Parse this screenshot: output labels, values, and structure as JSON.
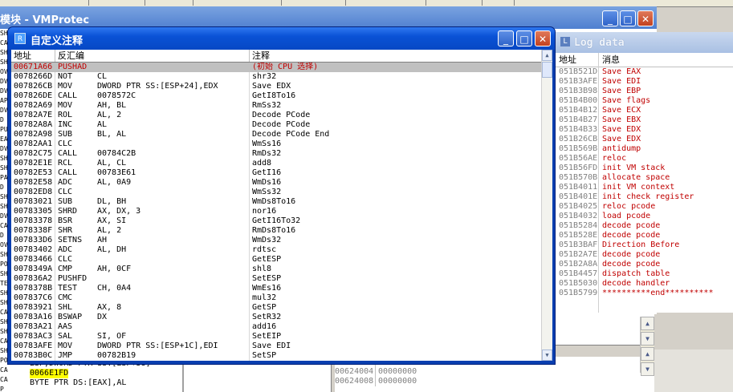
{
  "background_window": {
    "title": "模块 - VMProtec",
    "left_gutter": [
      "SH",
      "CA",
      "SH",
      "SH",
      "OV",
      "DV",
      "DV",
      "AP",
      "DV",
      "D",
      "PU",
      "EA",
      "DV",
      "SH",
      "SH",
      "PA",
      "D",
      "SH",
      "SH",
      "DV",
      "CA",
      "D",
      "OV",
      "SH",
      "PO",
      "SH",
      "TE",
      "SH",
      "SH",
      "CA",
      "SH",
      "SH",
      "CA",
      "SH",
      "PO",
      "CA",
      "CA",
      "P",
      "D"
    ],
    "bottom_rows": [
      {
        "op": "ESP,DWORD PTR SS:[ESP+38]"
      },
      {
        "op": "0066E1FD"
      },
      {
        "op": "BYTE PTR DS:[EAX],AL"
      }
    ],
    "bottom_gutter": [
      "CA",
      "P",
      "D"
    ]
  },
  "dump": {
    "rows": [
      {
        "addr": "00624000",
        "val": "00000000"
      },
      {
        "addr": "00624004",
        "val": "00000000"
      },
      {
        "addr": "00624008",
        "val": "00000000"
      }
    ]
  },
  "log_window": {
    "title": "Log data",
    "icon": "L",
    "col_address": "地址",
    "col_message": "消息",
    "rows": [
      {
        "addr": "051B521D",
        "msg": "Save EAX"
      },
      {
        "addr": "051B3AFE",
        "msg": "Save EDI"
      },
      {
        "addr": "051B3B98",
        "msg": "Save EBP"
      },
      {
        "addr": "051B4B00",
        "msg": "Save flags"
      },
      {
        "addr": "051B4B12",
        "msg": "Save ECX"
      },
      {
        "addr": "051B4B27",
        "msg": "Save EBX"
      },
      {
        "addr": "051B4B33",
        "msg": "Save EDX"
      },
      {
        "addr": "051B26CB",
        "msg": "Save EDX"
      },
      {
        "addr": "051B569B",
        "msg": "antidump"
      },
      {
        "addr": "051B56AE",
        "msg": "reloc"
      },
      {
        "addr": "051B56FD",
        "msg": "init VM stack"
      },
      {
        "addr": "051B570B",
        "msg": "allocate space"
      },
      {
        "addr": "051B4011",
        "msg": "init VM context"
      },
      {
        "addr": "051B401E",
        "msg": "init check register"
      },
      {
        "addr": "051B4025",
        "msg": "reloc pcode"
      },
      {
        "addr": "051B4032",
        "msg": "load pcode"
      },
      {
        "addr": "051B5284",
        "msg": "decode pcode"
      },
      {
        "addr": "051B528E",
        "msg": "decode pcode"
      },
      {
        "addr": "051B3BAF",
        "msg": "Direction Before"
      },
      {
        "addr": "051B2A7E",
        "msg": "decode pcode"
      },
      {
        "addr": "051B2A8A",
        "msg": "decode pcode"
      },
      {
        "addr": "051B4457",
        "msg": "dispatch table"
      },
      {
        "addr": "051B5030",
        "msg": "decode handler"
      },
      {
        "addr": "051B5799",
        "msg": "**********end**********"
      }
    ]
  },
  "dialog": {
    "title": "自定义注释",
    "icon": "R",
    "col_address": "地址",
    "col_disasm": "反汇编",
    "col_comment": "注释",
    "rows": [
      {
        "addr": "00671A66",
        "mn": "PUSHAD",
        "op": "",
        "cm": "(初始 CPU 选择)",
        "sel": true
      },
      {
        "addr": "0078266D",
        "mn": "NOT",
        "op": "CL",
        "cm": "shr32"
      },
      {
        "addr": "007826CB",
        "mn": "MOV",
        "op": "DWORD PTR SS:[ESP+24],EDX",
        "cm": "Save EDX"
      },
      {
        "addr": "007826DE",
        "mn": "CALL",
        "op": "0078572C",
        "cm": "GetI8To16"
      },
      {
        "addr": "00782A69",
        "mn": "MOV",
        "op": "AH, BL",
        "cm": "RmSs32"
      },
      {
        "addr": "00782A7E",
        "mn": "ROL",
        "op": "AL, 2",
        "cm": "Decode PCode"
      },
      {
        "addr": "00782A8A",
        "mn": "INC",
        "op": "AL",
        "cm": "Decode PCode"
      },
      {
        "addr": "00782A98",
        "mn": "SUB",
        "op": "BL, AL",
        "cm": "Decode PCode End"
      },
      {
        "addr": "00782AA1",
        "mn": "CLC",
        "op": "",
        "cm": "WmSs16"
      },
      {
        "addr": "00782C75",
        "mn": "CALL",
        "op": "00784C2B",
        "cm": "RmDs32"
      },
      {
        "addr": "00782E1E",
        "mn": "RCL",
        "op": "AL, CL",
        "cm": "add8"
      },
      {
        "addr": "00782E53",
        "mn": "CALL",
        "op": "00783E61",
        "cm": "GetI16"
      },
      {
        "addr": "00782E58",
        "mn": "ADC",
        "op": "AL, 0A9",
        "cm": "WmDs16"
      },
      {
        "addr": "00782ED8",
        "mn": "CLC",
        "op": "",
        "cm": "WmSs32"
      },
      {
        "addr": "00783021",
        "mn": "SUB",
        "op": "DL, BH",
        "cm": "WmDs8To16"
      },
      {
        "addr": "00783305",
        "mn": "SHRD",
        "op": "AX, DX, 3",
        "cm": "nor16"
      },
      {
        "addr": "00783378",
        "mn": "BSR",
        "op": "AX, SI",
        "cm": "GetI16To32"
      },
      {
        "addr": "0078338F",
        "mn": "SHR",
        "op": "AL, 2",
        "cm": "RmDs8To16"
      },
      {
        "addr": "007833D6",
        "mn": "SETNS",
        "op": "AH",
        "cm": "WmDs32"
      },
      {
        "addr": "00783402",
        "mn": "ADC",
        "op": "AL, DH",
        "cm": "rdtsc"
      },
      {
        "addr": "00783466",
        "mn": "CLC",
        "op": "",
        "cm": "GetESP"
      },
      {
        "addr": "0078349A",
        "mn": "CMP",
        "op": "AH, 0CF",
        "cm": "shl8"
      },
      {
        "addr": "007836A2",
        "mn": "PUSHFD",
        "op": "",
        "cm": "SetESP"
      },
      {
        "addr": "0078378B",
        "mn": "TEST",
        "op": "CH, 0A4",
        "cm": "WmEs16"
      },
      {
        "addr": "007837C6",
        "mn": "CMC",
        "op": "",
        "cm": "mul32"
      },
      {
        "addr": "00783921",
        "mn": "SHL",
        "op": "AX, 8",
        "cm": "GetSP"
      },
      {
        "addr": "00783A16",
        "mn": "BSWAP",
        "op": "DX",
        "cm": "SetR32"
      },
      {
        "addr": "00783A21",
        "mn": "AAS",
        "op": "",
        "cm": "add16"
      },
      {
        "addr": "00783AC3",
        "mn": "SAL",
        "op": "SI, OF",
        "cm": "SetEIP"
      },
      {
        "addr": "00783AFE",
        "mn": "MOV",
        "op": "DWORD PTR SS:[ESP+1C],EDI",
        "cm": "Save EDI"
      },
      {
        "addr": "00783B0C",
        "mn": "JMP",
        "op": "00782B19",
        "cm": "SetSP"
      }
    ]
  },
  "colors": {
    "selection_text": "#c00000",
    "log_message": "#c00000",
    "title_blue": "#0a52d6"
  }
}
